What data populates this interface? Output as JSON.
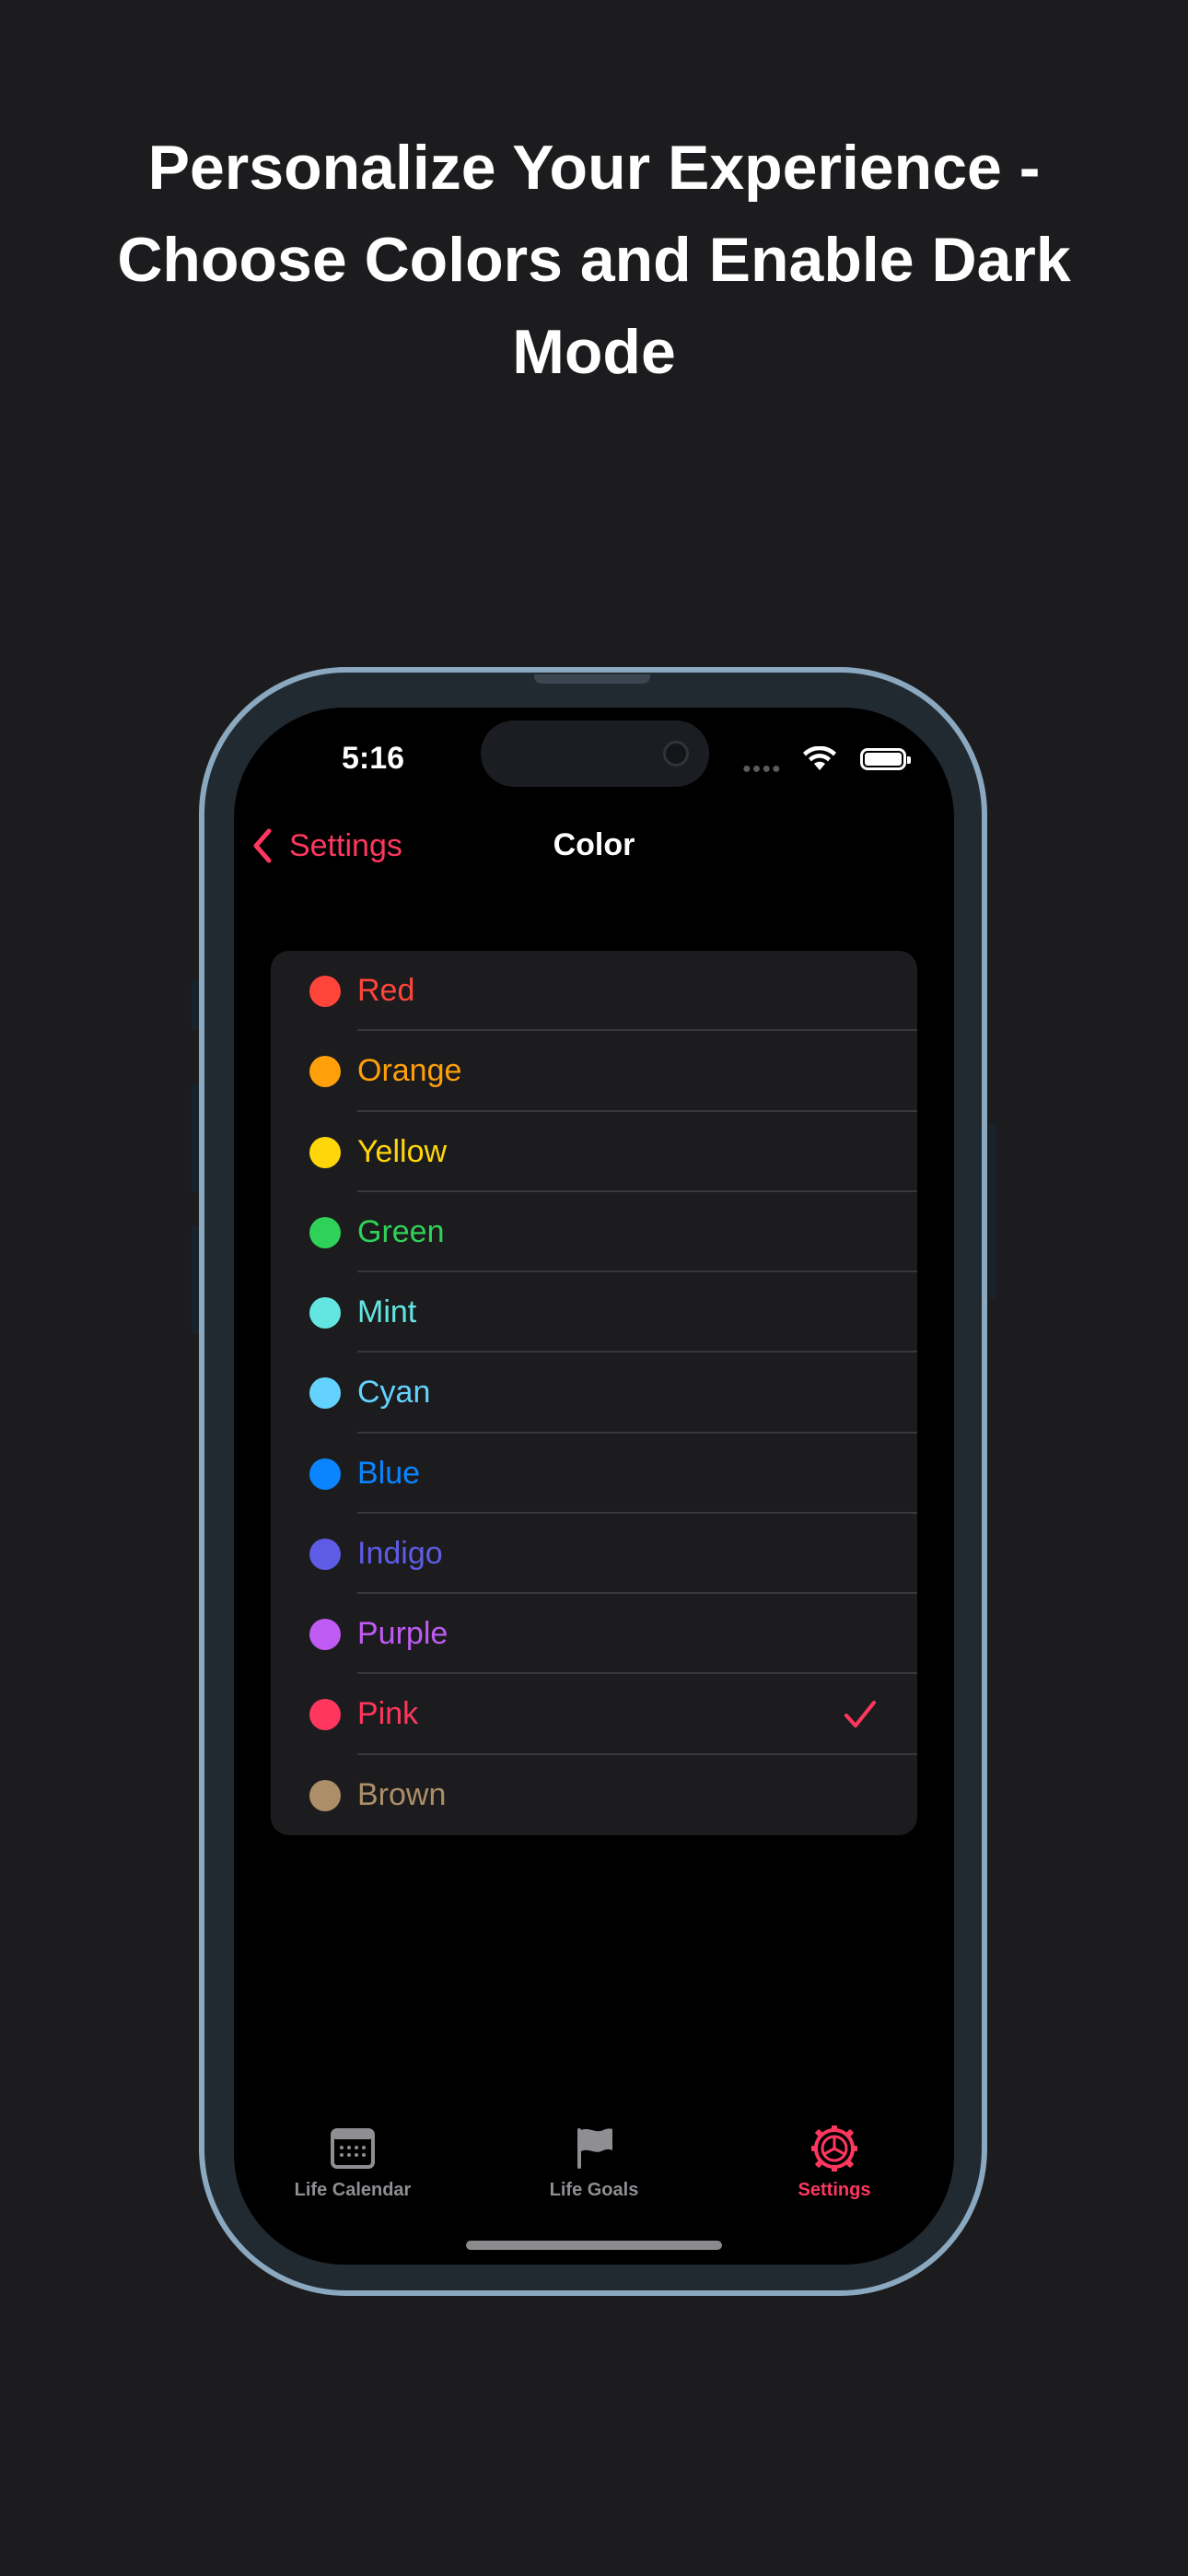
{
  "headline": "Personalize Your Experience - Choose Colors and Enable Dark Mode",
  "status_bar": {
    "time": "5:16"
  },
  "nav": {
    "back_label": "Settings",
    "title": "Color"
  },
  "colors": [
    {
      "label": "Red",
      "color": "#ff453a",
      "selected": false
    },
    {
      "label": "Orange",
      "color": "#ff9f0a",
      "selected": false
    },
    {
      "label": "Yellow",
      "color": "#ffd60a",
      "selected": false
    },
    {
      "label": "Green",
      "color": "#30d158",
      "selected": false
    },
    {
      "label": "Mint",
      "color": "#63e6e2",
      "selected": false
    },
    {
      "label": "Cyan",
      "color": "#64d2ff",
      "selected": false
    },
    {
      "label": "Blue",
      "color": "#0a84ff",
      "selected": false
    },
    {
      "label": "Indigo",
      "color": "#5e5ce6",
      "selected": false
    },
    {
      "label": "Purple",
      "color": "#bf5af2",
      "selected": false
    },
    {
      "label": "Pink",
      "color": "#ff375f",
      "selected": true
    },
    {
      "label": "Brown",
      "color": "#ac8e68",
      "selected": false
    }
  ],
  "tabbar": {
    "items": [
      {
        "label": "Life Calendar",
        "icon": "calendar-icon",
        "active": false
      },
      {
        "label": "Life Goals",
        "icon": "flag-icon",
        "active": false
      },
      {
        "label": "Settings",
        "icon": "gear-icon",
        "active": true
      }
    ]
  },
  "theme": {
    "accent": "#ff375f",
    "background": "#1c1c1e",
    "screen": "#000000",
    "frame": "#8aa8c0"
  }
}
